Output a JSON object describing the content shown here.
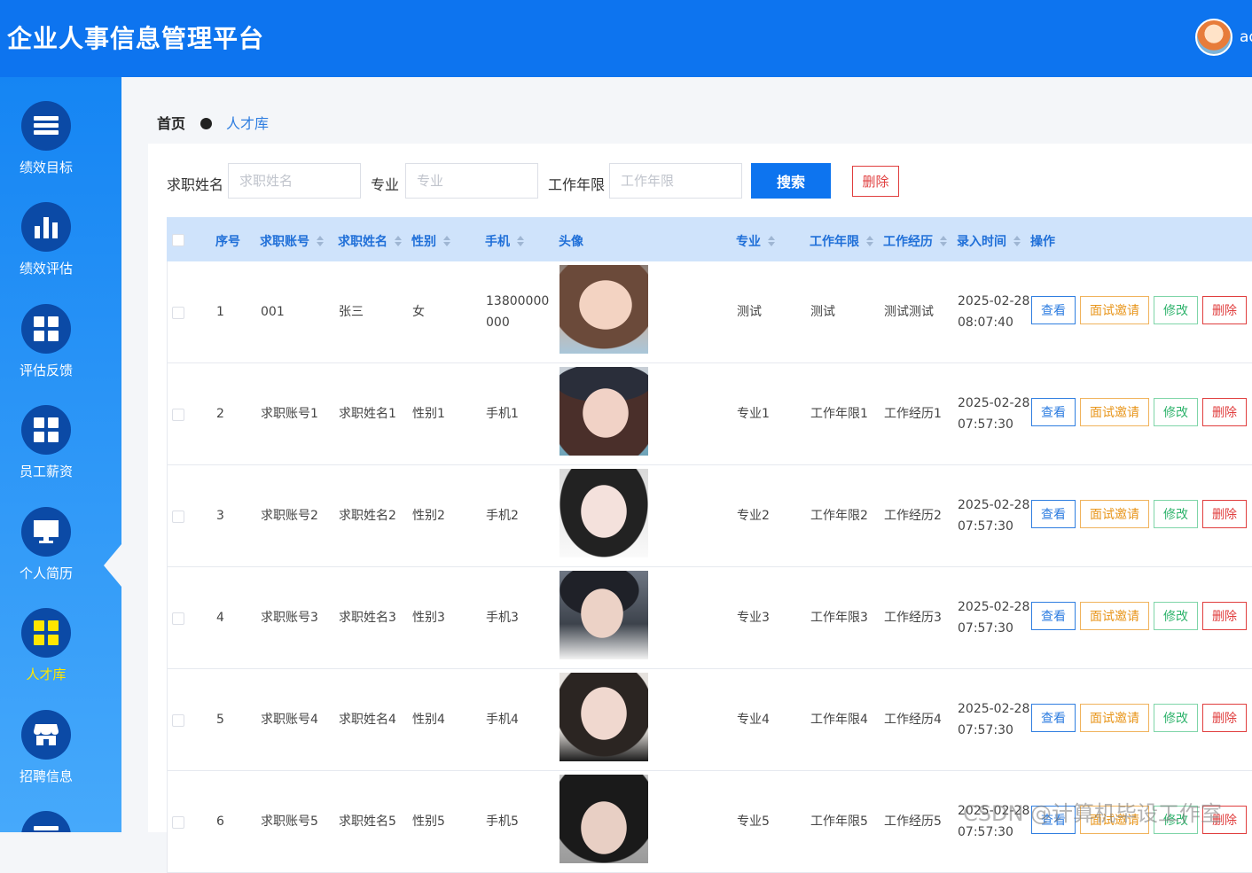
{
  "header": {
    "title": "企业人事信息管理平台",
    "username": "ad"
  },
  "sidebar": {
    "items": [
      {
        "label": "绩效目标",
        "icon": "list-icon",
        "active": false
      },
      {
        "label": "绩效评估",
        "icon": "bar-chart-icon",
        "active": false
      },
      {
        "label": "评估反馈",
        "icon": "grid-icon",
        "active": false
      },
      {
        "label": "员工薪资",
        "icon": "grid-icon",
        "active": false
      },
      {
        "label": "个人简历",
        "icon": "monitor-icon",
        "active": false
      },
      {
        "label": "人才库",
        "icon": "grid-icon",
        "active": true
      },
      {
        "label": "招聘信息",
        "icon": "store-icon",
        "active": false
      }
    ],
    "active_color": "#ffe600"
  },
  "breadcrumb": {
    "home": "首页",
    "current": "人才库"
  },
  "search": {
    "name_label": "求职姓名",
    "name_placeholder": "求职姓名",
    "major_label": "专业",
    "major_placeholder": "专业",
    "years_label": "工作年限",
    "years_placeholder": "工作年限",
    "search_button": "搜索",
    "delete_button": "删除"
  },
  "table": {
    "columns": [
      "序号",
      "求职账号",
      "求职姓名",
      "性别",
      "手机",
      "头像",
      "专业",
      "工作年限",
      "工作经历",
      "录入时间",
      "操作"
    ],
    "action_labels": {
      "view": "查看",
      "invite": "面试邀请",
      "edit": "修改",
      "delete": "删除"
    },
    "rows": [
      {
        "index": "1",
        "account": "001",
        "name": "张三",
        "gender": "女",
        "phone": "13800000000",
        "major": "测试",
        "years": "测试",
        "experience": "测试测试",
        "date": "2025-02-28",
        "time": "08:07:40"
      },
      {
        "index": "2",
        "account": "求职账号1",
        "name": "求职姓名1",
        "gender": "性别1",
        "phone": "手机1",
        "major": "专业1",
        "years": "工作年限1",
        "experience": "工作经历1",
        "date": "2025-02-28",
        "time": "07:57:30"
      },
      {
        "index": "3",
        "account": "求职账号2",
        "name": "求职姓名2",
        "gender": "性别2",
        "phone": "手机2",
        "major": "专业2",
        "years": "工作年限2",
        "experience": "工作经历2",
        "date": "2025-02-28",
        "time": "07:57:30"
      },
      {
        "index": "4",
        "account": "求职账号3",
        "name": "求职姓名3",
        "gender": "性别3",
        "phone": "手机3",
        "major": "专业3",
        "years": "工作年限3",
        "experience": "工作经历3",
        "date": "2025-02-28",
        "time": "07:57:30"
      },
      {
        "index": "5",
        "account": "求职账号4",
        "name": "求职姓名4",
        "gender": "性别4",
        "phone": "手机4",
        "major": "专业4",
        "years": "工作年限4",
        "experience": "工作经历4",
        "date": "2025-02-28",
        "time": "07:57:30"
      },
      {
        "index": "6",
        "account": "求职账号5",
        "name": "求职姓名5",
        "gender": "性别5",
        "phone": "手机5",
        "major": "专业5",
        "years": "工作年限5",
        "experience": "工作经历5",
        "date": "2025-02-28",
        "time": "07:57:30"
      }
    ]
  },
  "watermark": "CSDN @计算机毕设工作室",
  "colors": {
    "header": "#0d74ef",
    "primary": "#2f7ee0",
    "danger": "#e03e3e",
    "warning": "#e8961c",
    "success": "#2fb36c"
  }
}
